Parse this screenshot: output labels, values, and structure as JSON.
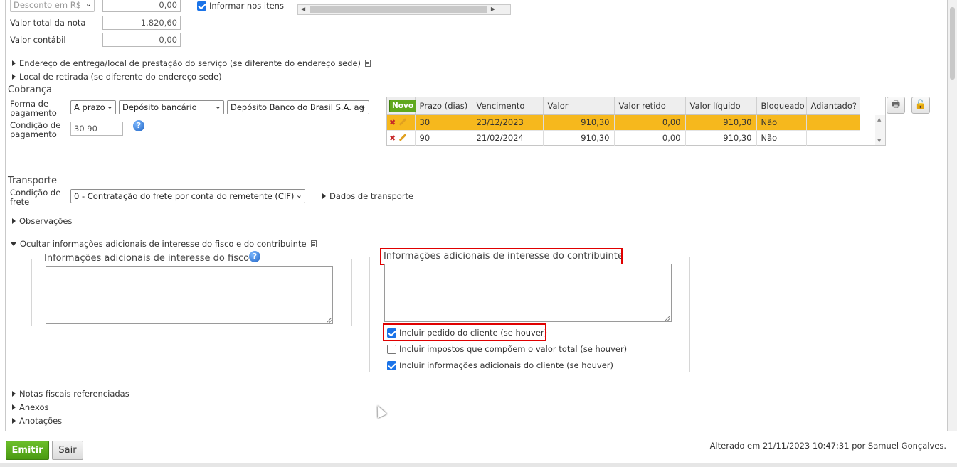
{
  "top": {
    "desconto_select": "Desconto em R$",
    "desconto_value": "0,00",
    "informar_itens_label": "Informar nos itens",
    "valor_total_label": "Valor total da nota",
    "valor_total_value": "1.820,60",
    "valor_contabil_label": "Valor contábil",
    "valor_contabil_value": "0,00",
    "endereco_entrega": "Endereço de entrega/local de prestação do serviço (se diferente do endereço sede)",
    "local_retirada": "Local de retirada (se diferente do endereço sede)"
  },
  "cobranca": {
    "title": "Cobrança",
    "forma_label": "Forma de pagamento",
    "forma_option1": "A prazo",
    "forma_option2": "Depósito bancário",
    "forma_option3": "Depósito Banco do Brasil S.A. ag",
    "condicao_label": "Condição de pagamento",
    "condicao_value": "30 90",
    "grid": {
      "novo_label": "Novo",
      "columns": [
        "Prazo (dias)",
        "Vencimento",
        "Valor",
        "Valor retido",
        "Valor líquido",
        "Bloqueado",
        "Adiantado?"
      ],
      "rows": [
        {
          "prazo": "30",
          "vencimento": "23/12/2023",
          "valor": "910,30",
          "retido": "0,00",
          "liquido": "910,30",
          "bloqueado": "Não",
          "adiantado": ""
        },
        {
          "prazo": "90",
          "vencimento": "21/02/2024",
          "valor": "910,30",
          "retido": "0,00",
          "liquido": "910,30",
          "bloqueado": "Não",
          "adiantado": ""
        }
      ]
    }
  },
  "transporte": {
    "title": "Transporte",
    "condicao_frete_label": "Condição de frete",
    "condicao_frete_value": "0 - Contratação do frete por conta do remetente (CIF)",
    "dados_transporte": "Dados de transporte"
  },
  "observacoes": "Observações",
  "info_adicionais": {
    "toggle": "Ocultar informações adicionais de interesse do fisco e do contribuinte",
    "fisco_title": "Informações adicionais de interesse do fisco",
    "contribuinte_title": "Informações adicionais de interesse do contribuinte",
    "check1": "Incluir pedido do cliente (se houver)",
    "check2": "Incluir impostos que compõem o valor total (se houver)",
    "check3": "Incluir informações adicionais do cliente (se houver)"
  },
  "notas_referenciadas": "Notas fiscais referenciadas",
  "anexos": "Anexos",
  "anotacoes": "Anotações",
  "footer": {
    "emitir": "Emitir",
    "sair": "Sair",
    "alterado": "Alterado em 21/11/2023 10:47:31 por Samuel Gonçalves."
  }
}
